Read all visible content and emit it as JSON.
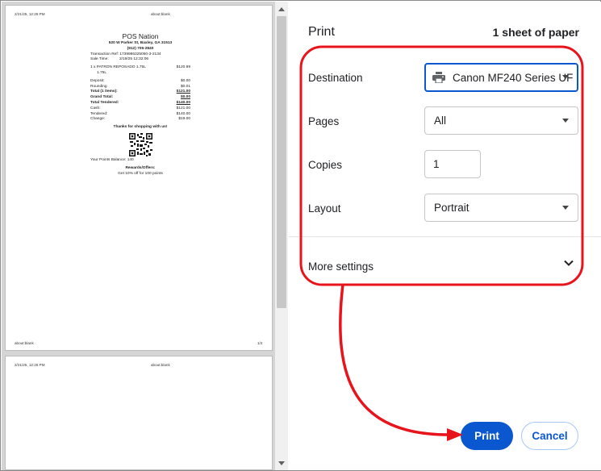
{
  "preview": {
    "header_date": "2/21/25, 12:28 PM",
    "header_url": "about:blank",
    "footer_url": "about:blank",
    "footer_page": "1/2",
    "page2_header_date": "2/21/25, 12:28 PM",
    "page2_header_url": "about:blank",
    "receipt": {
      "store_name": "POS Nation",
      "address": "520 W Parker St, Baxley, GA 31513",
      "phone": "(912) 705-2840",
      "transaction_ref": "Transaction Ref: 1739986325050-3-2134",
      "sale_time_label": "Sale Time:",
      "sale_time_value": "2/19/25 12:32:06",
      "item_line": "1 x PATRON REPOSADO 1.75L",
      "item_price": "$120.99",
      "item_sub": "1.75L",
      "rows": [
        {
          "label": "Deposit:",
          "value": "$0.00",
          "bold": false
        },
        {
          "label": "Rounding",
          "value": "$0.01",
          "bold": false
        },
        {
          "label": "Total (1 items):",
          "value": "$121.00",
          "bold": true
        },
        {
          "label": "Grand Total:",
          "value": "$0.00",
          "bold": true
        },
        {
          "label": "Total Tendered:",
          "value": "$140.00",
          "bold": true
        },
        {
          "label": "Cash:",
          "value": "$121.00",
          "bold": false
        },
        {
          "label": "Tendered:",
          "value": "$140.00",
          "bold": false
        },
        {
          "label": "Change:",
          "value": "$19.00",
          "bold": false
        }
      ],
      "thanks": "Thanks for shopping with us!",
      "points_balance": "Your Points Balance: 140",
      "rewards_title": "Rewards/Offers:",
      "rewards_offer": "Get 10% off for 100 points"
    }
  },
  "settings": {
    "title": "Print",
    "sheet_count": "1 sheet of paper",
    "destination_label": "Destination",
    "destination_value": "Canon MF240 Series UF",
    "pages_label": "Pages",
    "pages_value": "All",
    "copies_label": "Copies",
    "copies_value": "1",
    "layout_label": "Layout",
    "layout_value": "Portrait",
    "more_settings_label": "More settings",
    "print_button": "Print",
    "cancel_button": "Cancel"
  },
  "colors": {
    "accent": "#0b57d0",
    "annotation_red": "#e8141b"
  },
  "icons": [
    "printer-icon",
    "chevron-down-icon",
    "caret-down-icon",
    "scroll-up-arrow-icon",
    "scroll-down-arrow-icon",
    "qr-code"
  ]
}
